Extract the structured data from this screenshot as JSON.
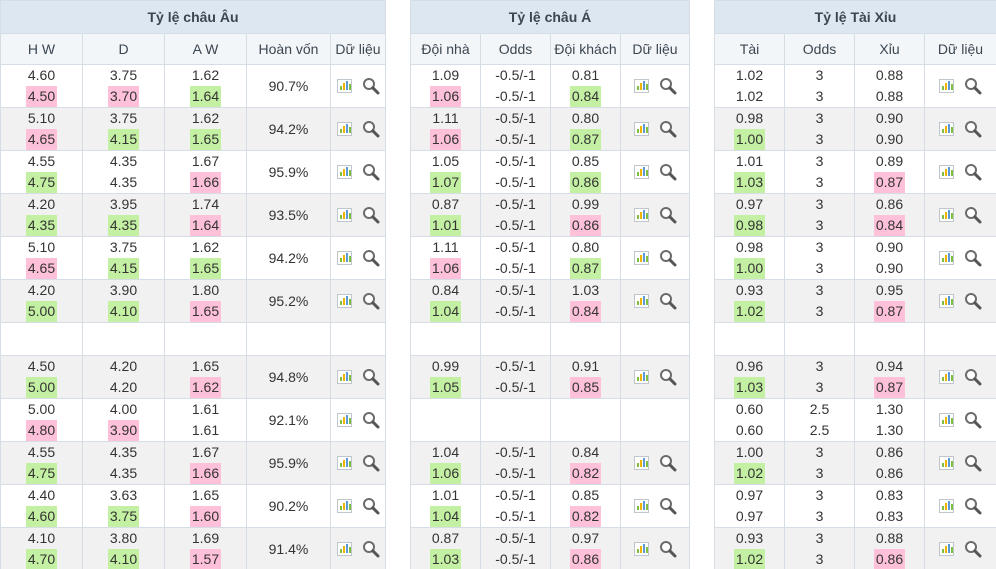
{
  "eu": {
    "title": "Tỷ lệ châu Âu",
    "headers": [
      "H W",
      "D",
      "A W",
      "Hoàn vốn",
      "Dữ liệu"
    ],
    "rows": [
      {
        "hw": [
          "4.60",
          "4.50"
        ],
        "d": [
          "3.75",
          "3.70"
        ],
        "aw": [
          "1.62",
          "1.64"
        ],
        "hwc": [
          "",
          "up"
        ],
        "dc": [
          "",
          "up"
        ],
        "awc": [
          "",
          "down"
        ],
        "ret": "90.7%"
      },
      {
        "hw": [
          "5.10",
          "4.65"
        ],
        "d": [
          "3.75",
          "4.15"
        ],
        "aw": [
          "1.62",
          "1.65"
        ],
        "hwc": [
          "",
          "up"
        ],
        "dc": [
          "",
          "down"
        ],
        "awc": [
          "",
          "down"
        ],
        "ret": "94.2%"
      },
      {
        "hw": [
          "4.55",
          "4.75"
        ],
        "d": [
          "4.35",
          "4.35"
        ],
        "aw": [
          "1.67",
          "1.66"
        ],
        "hwc": [
          "",
          "down"
        ],
        "dc": [
          "",
          ""
        ],
        "awc": [
          "",
          "up"
        ],
        "ret": "95.9%"
      },
      {
        "hw": [
          "4.20",
          "4.35"
        ],
        "d": [
          "3.95",
          "4.35"
        ],
        "aw": [
          "1.74",
          "1.64"
        ],
        "hwc": [
          "",
          "down"
        ],
        "dc": [
          "",
          "down"
        ],
        "awc": [
          "",
          "up"
        ],
        "ret": "93.5%"
      },
      {
        "hw": [
          "5.10",
          "4.65"
        ],
        "d": [
          "3.75",
          "4.15"
        ],
        "aw": [
          "1.62",
          "1.65"
        ],
        "hwc": [
          "",
          "up"
        ],
        "dc": [
          "",
          "down"
        ],
        "awc": [
          "",
          "down"
        ],
        "ret": "94.2%"
      },
      {
        "hw": [
          "4.20",
          "5.00"
        ],
        "d": [
          "3.90",
          "4.10"
        ],
        "aw": [
          "1.80",
          "1.65"
        ],
        "hwc": [
          "",
          "down"
        ],
        "dc": [
          "",
          "down"
        ],
        "awc": [
          "",
          "up"
        ],
        "ret": "95.2%"
      },
      {
        "blank": true
      },
      {
        "hw": [
          "4.50",
          "5.00"
        ],
        "d": [
          "4.20",
          "4.20"
        ],
        "aw": [
          "1.65",
          "1.62"
        ],
        "hwc": [
          "",
          "down"
        ],
        "dc": [
          "",
          ""
        ],
        "awc": [
          "",
          "up"
        ],
        "ret": "94.8%"
      },
      {
        "hw": [
          "5.00",
          "4.80"
        ],
        "d": [
          "4.00",
          "3.90"
        ],
        "aw": [
          "1.61",
          "1.61"
        ],
        "hwc": [
          "",
          "up"
        ],
        "dc": [
          "",
          "up"
        ],
        "awc": [
          "",
          ""
        ],
        "ret": "92.1%"
      },
      {
        "hw": [
          "4.55",
          "4.75"
        ],
        "d": [
          "4.35",
          "4.35"
        ],
        "aw": [
          "1.67",
          "1.66"
        ],
        "hwc": [
          "",
          "down"
        ],
        "dc": [
          "",
          ""
        ],
        "awc": [
          "",
          "up"
        ],
        "ret": "95.9%"
      },
      {
        "hw": [
          "4.40",
          "4.60"
        ],
        "d": [
          "3.63",
          "3.75"
        ],
        "aw": [
          "1.65",
          "1.60"
        ],
        "hwc": [
          "",
          "down"
        ],
        "dc": [
          "",
          "down"
        ],
        "awc": [
          "",
          "up"
        ],
        "ret": "90.2%"
      },
      {
        "hw": [
          "4.10",
          "4.70"
        ],
        "d": [
          "3.80",
          "4.10"
        ],
        "aw": [
          "1.69",
          "1.57"
        ],
        "hwc": [
          "",
          "down"
        ],
        "dc": [
          "",
          "down"
        ],
        "awc": [
          "",
          "up"
        ],
        "ret": "91.4%"
      }
    ]
  },
  "asia": {
    "title": "Tỷ lệ châu Á",
    "headers": [
      "Đội nhà",
      "Odds",
      "Đội khách",
      "Dữ liệu"
    ],
    "rows": [
      {
        "h": [
          "1.09",
          "1.06"
        ],
        "o": [
          "-0.5/-1",
          "-0.5/-1"
        ],
        "a": [
          "0.81",
          "0.84"
        ],
        "hc": [
          "",
          "up"
        ],
        "ac": [
          "",
          "down"
        ],
        "icons": true
      },
      {
        "h": [
          "1.11",
          "1.06"
        ],
        "o": [
          "-0.5/-1",
          "-0.5/-1"
        ],
        "a": [
          "0.80",
          "0.87"
        ],
        "hc": [
          "",
          "up"
        ],
        "ac": [
          "",
          "down"
        ],
        "icons": true
      },
      {
        "h": [
          "1.05",
          "1.07"
        ],
        "o": [
          "-0.5/-1",
          "-0.5/-1"
        ],
        "a": [
          "0.85",
          "0.86"
        ],
        "hc": [
          "",
          "down"
        ],
        "ac": [
          "",
          "down"
        ],
        "icons": true
      },
      {
        "h": [
          "0.87",
          "1.01"
        ],
        "o": [
          "-0.5/-1",
          "-0.5/-1"
        ],
        "a": [
          "0.99",
          "0.86"
        ],
        "hc": [
          "",
          "down"
        ],
        "ac": [
          "",
          "up"
        ],
        "icons": true
      },
      {
        "h": [
          "1.11",
          "1.06"
        ],
        "o": [
          "-0.5/-1",
          "-0.5/-1"
        ],
        "a": [
          "0.80",
          "0.87"
        ],
        "hc": [
          "",
          "up"
        ],
        "ac": [
          "",
          "down"
        ],
        "icons": true
      },
      {
        "h": [
          "0.84",
          "1.04"
        ],
        "o": [
          "-0.5/-1",
          "-0.5/-1"
        ],
        "a": [
          "1.03",
          "0.84"
        ],
        "hc": [
          "",
          "down"
        ],
        "ac": [
          "",
          "up"
        ],
        "icons": true
      },
      {
        "blank": true
      },
      {
        "h": [
          "0.99",
          "1.05"
        ],
        "o": [
          "-0.5/-1",
          "-0.5/-1"
        ],
        "a": [
          "0.91",
          "0.85"
        ],
        "hc": [
          "",
          "down"
        ],
        "ac": [
          "",
          "up"
        ],
        "icons": true
      },
      {
        "h": [
          "",
          ""
        ],
        "o": [
          "",
          ""
        ],
        "a": [
          "",
          ""
        ],
        "hc": [
          "",
          ""
        ],
        "ac": [
          "",
          ""
        ],
        "icons": false
      },
      {
        "h": [
          "1.04",
          "1.06"
        ],
        "o": [
          "-0.5/-1",
          "-0.5/-1"
        ],
        "a": [
          "0.84",
          "0.82"
        ],
        "hc": [
          "",
          "down"
        ],
        "ac": [
          "",
          "up"
        ],
        "icons": true
      },
      {
        "h": [
          "1.01",
          "1.04"
        ],
        "o": [
          "-0.5/-1",
          "-0.5/-1"
        ],
        "a": [
          "0.85",
          "0.82"
        ],
        "hc": [
          "",
          "down"
        ],
        "ac": [
          "",
          "up"
        ],
        "icons": true
      },
      {
        "h": [
          "0.87",
          "1.03"
        ],
        "o": [
          "-0.5/-1",
          "-0.5/-1"
        ],
        "a": [
          "0.97",
          "0.86"
        ],
        "hc": [
          "",
          "down"
        ],
        "ac": [
          "",
          "up"
        ],
        "icons": true
      }
    ]
  },
  "ou": {
    "title": "Tỷ lệ Tài Xỉu",
    "headers": [
      "Tài",
      "Odds",
      "Xỉu",
      "Dữ liệu"
    ],
    "rows": [
      {
        "t": [
          "1.02",
          "1.02"
        ],
        "o": [
          "3",
          "3"
        ],
        "x": [
          "0.88",
          "0.88"
        ],
        "tc": [
          "",
          ""
        ],
        "xc": [
          "",
          ""
        ]
      },
      {
        "t": [
          "0.98",
          "1.00"
        ],
        "o": [
          "3",
          "3"
        ],
        "x": [
          "0.90",
          "0.90"
        ],
        "tc": [
          "",
          "down"
        ],
        "xc": [
          "",
          ""
        ]
      },
      {
        "t": [
          "1.01",
          "1.03"
        ],
        "o": [
          "3",
          "3"
        ],
        "x": [
          "0.89",
          "0.87"
        ],
        "tc": [
          "",
          "down"
        ],
        "xc": [
          "",
          "up"
        ]
      },
      {
        "t": [
          "0.97",
          "0.98"
        ],
        "o": [
          "3",
          "3"
        ],
        "x": [
          "0.86",
          "0.84"
        ],
        "tc": [
          "",
          "down"
        ],
        "xc": [
          "",
          "up"
        ]
      },
      {
        "t": [
          "0.98",
          "1.00"
        ],
        "o": [
          "3",
          "3"
        ],
        "x": [
          "0.90",
          "0.90"
        ],
        "tc": [
          "",
          "down"
        ],
        "xc": [
          "",
          ""
        ]
      },
      {
        "t": [
          "0.93",
          "1.02"
        ],
        "o": [
          "3",
          "3"
        ],
        "x": [
          "0.95",
          "0.87"
        ],
        "tc": [
          "",
          "down"
        ],
        "xc": [
          "",
          "up"
        ]
      },
      {
        "blank": true
      },
      {
        "t": [
          "0.96",
          "1.03"
        ],
        "o": [
          "3",
          "3"
        ],
        "x": [
          "0.94",
          "0.87"
        ],
        "tc": [
          "",
          "down"
        ],
        "xc": [
          "",
          "up"
        ]
      },
      {
        "t": [
          "0.60",
          "0.60"
        ],
        "o": [
          "2.5",
          "2.5"
        ],
        "x": [
          "1.30",
          "1.30"
        ],
        "tc": [
          "",
          ""
        ],
        "xc": [
          "",
          ""
        ]
      },
      {
        "t": [
          "1.00",
          "1.02"
        ],
        "o": [
          "3",
          "3"
        ],
        "x": [
          "0.86",
          "0.86"
        ],
        "tc": [
          "",
          "down"
        ],
        "xc": [
          "",
          ""
        ]
      },
      {
        "t": [
          "0.97",
          "0.97"
        ],
        "o": [
          "3",
          "3"
        ],
        "x": [
          "0.83",
          "0.83"
        ],
        "tc": [
          "",
          ""
        ],
        "xc": [
          "",
          ""
        ]
      },
      {
        "t": [
          "0.93",
          "1.02"
        ],
        "o": [
          "3",
          "3"
        ],
        "x": [
          "0.88",
          "0.86"
        ],
        "tc": [
          "",
          "down"
        ],
        "xc": [
          "",
          "up"
        ]
      }
    ]
  },
  "colors": {
    "up_highlight": "#ffc0da",
    "down_highlight": "#c3f0a2",
    "header_bg": "#dde7f1",
    "alt_row": "#f1f1f1"
  },
  "icons": {
    "chart": "bar-chart-icon",
    "search": "magnifier-icon"
  }
}
